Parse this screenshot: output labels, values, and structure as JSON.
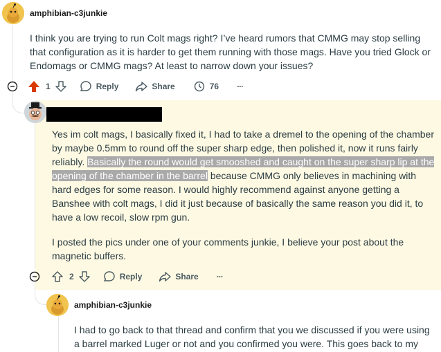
{
  "comments": [
    {
      "author": "amphibian-c3junkie",
      "body": "I think you are trying to run Colt mags right? I’ve heard rumors that CMMG may stop selling that configuration as it is harder to get them running with those mags. Have you tried Glock or Endomags or CMMG mags? At least to narrow down your issues?",
      "votes": "1",
      "reply_label": "Reply",
      "share_label": "Share",
      "awards": "76",
      "more_label": "···"
    },
    {
      "author": "",
      "body_p1_before": "Yes im colt mags, I basically fixed it, I had to take a dremel to the opening of the chamber by maybe 0.5mm to round off the super sharp edge, then polished it, now it runs fairly reliably. ",
      "body_p1_highlight": "Basically the round would get smooshed and caught on the super sharp lip at the opening of the chamber in the barrel",
      "body_p1_after": " because CMMG only believes in machining with hard edges for some reason. I would highly recommend against anyone getting a Banshee with colt mags, I did it just because of basically the same reason you did it, to have a low recoil, slow rpm gun.",
      "body_p2": "I posted the pics under one of your comments junkie, I believe your post about the magnetic buffers.",
      "votes": "2",
      "reply_label": "Reply",
      "share_label": "Share",
      "more_label": "···"
    },
    {
      "author": "amphibian-c3junkie",
      "body": "I had to go back to that thread and confirm that you we discussed if you were using a barrel marked Luger or not and you confirmed you were. This goes back to my"
    }
  ],
  "colors": {
    "upvote_active": "#d93a00",
    "highlight_bg": "#a9a9a9",
    "highlight_row": "#fef9e3"
  }
}
